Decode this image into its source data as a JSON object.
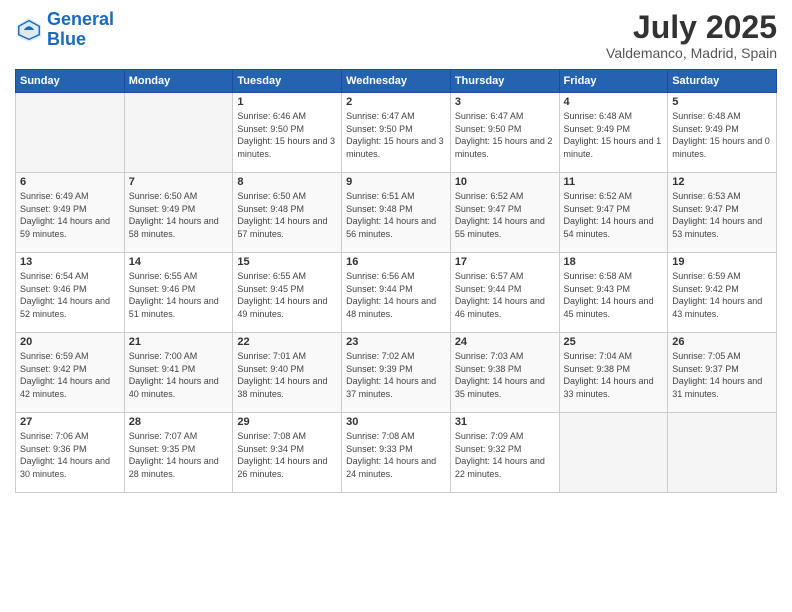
{
  "logo": {
    "line1": "General",
    "line2": "Blue"
  },
  "title": "July 2025",
  "location": "Valdemanco, Madrid, Spain",
  "days_of_week": [
    "Sunday",
    "Monday",
    "Tuesday",
    "Wednesday",
    "Thursday",
    "Friday",
    "Saturday"
  ],
  "weeks": [
    [
      {
        "day": "",
        "sunrise": "",
        "sunset": "",
        "daylight": ""
      },
      {
        "day": "",
        "sunrise": "",
        "sunset": "",
        "daylight": ""
      },
      {
        "day": "1",
        "sunrise": "Sunrise: 6:46 AM",
        "sunset": "Sunset: 9:50 PM",
        "daylight": "Daylight: 15 hours and 3 minutes."
      },
      {
        "day": "2",
        "sunrise": "Sunrise: 6:47 AM",
        "sunset": "Sunset: 9:50 PM",
        "daylight": "Daylight: 15 hours and 3 minutes."
      },
      {
        "day": "3",
        "sunrise": "Sunrise: 6:47 AM",
        "sunset": "Sunset: 9:50 PM",
        "daylight": "Daylight: 15 hours and 2 minutes."
      },
      {
        "day": "4",
        "sunrise": "Sunrise: 6:48 AM",
        "sunset": "Sunset: 9:49 PM",
        "daylight": "Daylight: 15 hours and 1 minute."
      },
      {
        "day": "5",
        "sunrise": "Sunrise: 6:48 AM",
        "sunset": "Sunset: 9:49 PM",
        "daylight": "Daylight: 15 hours and 0 minutes."
      }
    ],
    [
      {
        "day": "6",
        "sunrise": "Sunrise: 6:49 AM",
        "sunset": "Sunset: 9:49 PM",
        "daylight": "Daylight: 14 hours and 59 minutes."
      },
      {
        "day": "7",
        "sunrise": "Sunrise: 6:50 AM",
        "sunset": "Sunset: 9:49 PM",
        "daylight": "Daylight: 14 hours and 58 minutes."
      },
      {
        "day": "8",
        "sunrise": "Sunrise: 6:50 AM",
        "sunset": "Sunset: 9:48 PM",
        "daylight": "Daylight: 14 hours and 57 minutes."
      },
      {
        "day": "9",
        "sunrise": "Sunrise: 6:51 AM",
        "sunset": "Sunset: 9:48 PM",
        "daylight": "Daylight: 14 hours and 56 minutes."
      },
      {
        "day": "10",
        "sunrise": "Sunrise: 6:52 AM",
        "sunset": "Sunset: 9:47 PM",
        "daylight": "Daylight: 14 hours and 55 minutes."
      },
      {
        "day": "11",
        "sunrise": "Sunrise: 6:52 AM",
        "sunset": "Sunset: 9:47 PM",
        "daylight": "Daylight: 14 hours and 54 minutes."
      },
      {
        "day": "12",
        "sunrise": "Sunrise: 6:53 AM",
        "sunset": "Sunset: 9:47 PM",
        "daylight": "Daylight: 14 hours and 53 minutes."
      }
    ],
    [
      {
        "day": "13",
        "sunrise": "Sunrise: 6:54 AM",
        "sunset": "Sunset: 9:46 PM",
        "daylight": "Daylight: 14 hours and 52 minutes."
      },
      {
        "day": "14",
        "sunrise": "Sunrise: 6:55 AM",
        "sunset": "Sunset: 9:46 PM",
        "daylight": "Daylight: 14 hours and 51 minutes."
      },
      {
        "day": "15",
        "sunrise": "Sunrise: 6:55 AM",
        "sunset": "Sunset: 9:45 PM",
        "daylight": "Daylight: 14 hours and 49 minutes."
      },
      {
        "day": "16",
        "sunrise": "Sunrise: 6:56 AM",
        "sunset": "Sunset: 9:44 PM",
        "daylight": "Daylight: 14 hours and 48 minutes."
      },
      {
        "day": "17",
        "sunrise": "Sunrise: 6:57 AM",
        "sunset": "Sunset: 9:44 PM",
        "daylight": "Daylight: 14 hours and 46 minutes."
      },
      {
        "day": "18",
        "sunrise": "Sunrise: 6:58 AM",
        "sunset": "Sunset: 9:43 PM",
        "daylight": "Daylight: 14 hours and 45 minutes."
      },
      {
        "day": "19",
        "sunrise": "Sunrise: 6:59 AM",
        "sunset": "Sunset: 9:42 PM",
        "daylight": "Daylight: 14 hours and 43 minutes."
      }
    ],
    [
      {
        "day": "20",
        "sunrise": "Sunrise: 6:59 AM",
        "sunset": "Sunset: 9:42 PM",
        "daylight": "Daylight: 14 hours and 42 minutes."
      },
      {
        "day": "21",
        "sunrise": "Sunrise: 7:00 AM",
        "sunset": "Sunset: 9:41 PM",
        "daylight": "Daylight: 14 hours and 40 minutes."
      },
      {
        "day": "22",
        "sunrise": "Sunrise: 7:01 AM",
        "sunset": "Sunset: 9:40 PM",
        "daylight": "Daylight: 14 hours and 38 minutes."
      },
      {
        "day": "23",
        "sunrise": "Sunrise: 7:02 AM",
        "sunset": "Sunset: 9:39 PM",
        "daylight": "Daylight: 14 hours and 37 minutes."
      },
      {
        "day": "24",
        "sunrise": "Sunrise: 7:03 AM",
        "sunset": "Sunset: 9:38 PM",
        "daylight": "Daylight: 14 hours and 35 minutes."
      },
      {
        "day": "25",
        "sunrise": "Sunrise: 7:04 AM",
        "sunset": "Sunset: 9:38 PM",
        "daylight": "Daylight: 14 hours and 33 minutes."
      },
      {
        "day": "26",
        "sunrise": "Sunrise: 7:05 AM",
        "sunset": "Sunset: 9:37 PM",
        "daylight": "Daylight: 14 hours and 31 minutes."
      }
    ],
    [
      {
        "day": "27",
        "sunrise": "Sunrise: 7:06 AM",
        "sunset": "Sunset: 9:36 PM",
        "daylight": "Daylight: 14 hours and 30 minutes."
      },
      {
        "day": "28",
        "sunrise": "Sunrise: 7:07 AM",
        "sunset": "Sunset: 9:35 PM",
        "daylight": "Daylight: 14 hours and 28 minutes."
      },
      {
        "day": "29",
        "sunrise": "Sunrise: 7:08 AM",
        "sunset": "Sunset: 9:34 PM",
        "daylight": "Daylight: 14 hours and 26 minutes."
      },
      {
        "day": "30",
        "sunrise": "Sunrise: 7:08 AM",
        "sunset": "Sunset: 9:33 PM",
        "daylight": "Daylight: 14 hours and 24 minutes."
      },
      {
        "day": "31",
        "sunrise": "Sunrise: 7:09 AM",
        "sunset": "Sunset: 9:32 PM",
        "daylight": "Daylight: 14 hours and 22 minutes."
      },
      {
        "day": "",
        "sunrise": "",
        "sunset": "",
        "daylight": ""
      },
      {
        "day": "",
        "sunrise": "",
        "sunset": "",
        "daylight": ""
      }
    ]
  ]
}
